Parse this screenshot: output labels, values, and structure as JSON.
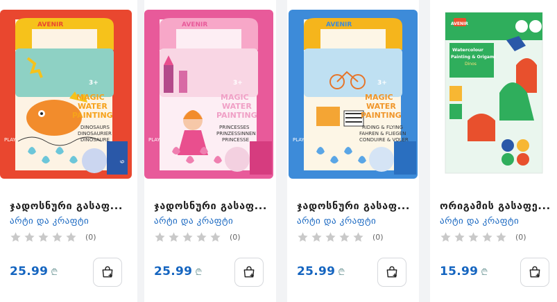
{
  "products": [
    {
      "title": "ჯადოსნური გასაფ...",
      "brand": "არტი და კრაფტი",
      "rating_count": "(0)",
      "price": "25.99",
      "currency": "₾",
      "cover": {
        "bg": "#e9472f",
        "frame": "#f6c21b",
        "panel": "#fdf3e4",
        "accent": "#f28c2c",
        "logo": "AVENIR",
        "lines": [
          "MAGIC",
          "WATER",
          "PAINTING"
        ],
        "sub": [
          "DINOSAURS",
          "DINOSAURIER",
          "DINOSAURE"
        ],
        "age": "3+",
        "side": "PLAY"
      }
    },
    {
      "title": "ჯადოსნური გასაფ...",
      "brand": "არტი და კრაფტი",
      "rating_count": "(0)",
      "price": "25.99",
      "currency": "₾",
      "cover": {
        "bg": "#e85a9a",
        "frame": "#f7a7c8",
        "panel": "#fdeef4",
        "accent": "#e94f8e",
        "logo": "AVENIR",
        "lines": [
          "MAGIC",
          "WATER",
          "PAINTING"
        ],
        "sub": [
          "PRINCESSES",
          "PRINZESSINNEN",
          "PRINCESSE"
        ],
        "age": "3+",
        "side": "PLAY"
      }
    },
    {
      "title": "ჯადოსნური გასაფ...",
      "brand": "არტი და კრაფტი",
      "rating_count": "(0)",
      "price": "25.99",
      "currency": "₾",
      "cover": {
        "bg": "#3d8bd9",
        "frame": "#f5b51c",
        "panel": "#fdf6e6",
        "accent": "#e6752a",
        "logo": "AVENIR",
        "lines": [
          "MAGIC",
          "WATER",
          "PAINTING"
        ],
        "sub": [
          "RIDING & FLYING",
          "FAHREN & FLIEGEN",
          "CONDUIRE & VOLER"
        ],
        "age": "3+",
        "side": "PLAY"
      }
    },
    {
      "title": "ორიგამის გასაფე...",
      "brand": "არტი და კრაფტი",
      "rating_count": "(0)",
      "price": "15.99",
      "currency": "₾",
      "cover": {
        "bg": "#2fae5c",
        "frame": "#ffffff",
        "panel": "#eaf6ee",
        "accent": "#e8502d",
        "logo": "AVENIR",
        "lines": [
          "Watercolour",
          "Painting & Origami",
          "Dinos"
        ],
        "sub": [],
        "age": "",
        "side": ""
      }
    }
  ],
  "colors": {
    "price": "#1565c0",
    "brand": "#1565c0",
    "star": "#c9c9c9"
  }
}
